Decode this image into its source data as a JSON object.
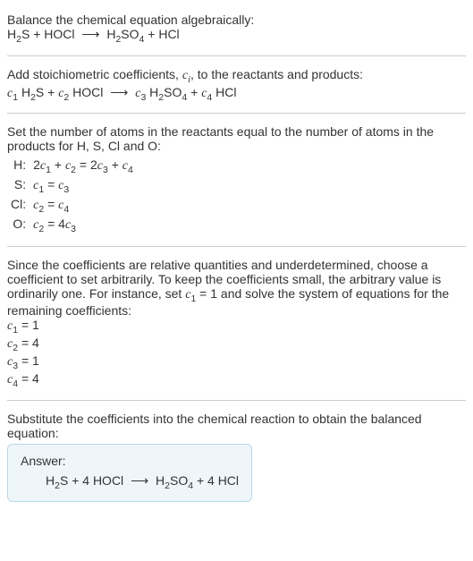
{
  "intro": {
    "line1_pre": "Balance the chemical equation algebraically:",
    "reaction_html": "H<sub>2</sub>S + HOCl <span class=\"arrow\">⟶</span> H<sub>2</sub>SO<sub>4</sub> + HCl"
  },
  "step_coeffs": {
    "text_html": "Add stoichiometric coefficients, <span class=\"ital\">c<sub>i</sub></span>, to the reactants and products:",
    "reaction_html": "<span class=\"ital\">c</span><sub>1</sub> H<sub>2</sub>S + <span class=\"ital\">c</span><sub>2</sub> HOCl <span class=\"arrow\">⟶</span> <span class=\"ital\">c</span><sub>3</sub> H<sub>2</sub>SO<sub>4</sub> + <span class=\"ital\">c</span><sub>4</sub> HCl"
  },
  "step_atoms": {
    "text": "Set the number of atoms in the reactants equal to the number of atoms in the products for H, S, Cl and O:",
    "rows": [
      {
        "el": "H:",
        "eq_html": "2<span class=\"ital\">c</span><sub>1</sub> + <span class=\"ital\">c</span><sub>2</sub> = 2<span class=\"ital\">c</span><sub>3</sub> + <span class=\"ital\">c</span><sub>4</sub>"
      },
      {
        "el": "S:",
        "eq_html": "<span class=\"ital\">c</span><sub>1</sub> = <span class=\"ital\">c</span><sub>3</sub>"
      },
      {
        "el": "Cl:",
        "eq_html": "<span class=\"ital\">c</span><sub>2</sub> = <span class=\"ital\">c</span><sub>4</sub>"
      },
      {
        "el": "O:",
        "eq_html": "<span class=\"ital\">c</span><sub>2</sub> = 4<span class=\"ital\">c</span><sub>3</sub>"
      }
    ]
  },
  "step_solve": {
    "text_html": "Since the coefficients are relative quantities and underdetermined, choose a coefficient to set arbitrarily. To keep the coefficients small, the arbitrary value is ordinarily one. For instance, set <span class=\"ital\">c</span><sub>1</sub> = 1 and solve the system of equations for the remaining coefficients:",
    "solutions_html": [
      "<span class=\"ital\">c</span><sub>1</sub> = 1",
      "<span class=\"ital\">c</span><sub>2</sub> = 4",
      "<span class=\"ital\">c</span><sub>3</sub> = 1",
      "<span class=\"ital\">c</span><sub>4</sub> = 4"
    ]
  },
  "step_sub": {
    "text": "Substitute the coefficients into the chemical reaction to obtain the balanced equation:"
  },
  "answer": {
    "label": "Answer:",
    "eq_html": "H<sub>2</sub>S + 4 HOCl <span class=\"arrow\">⟶</span> H<sub>2</sub>SO<sub>4</sub> + 4 HCl"
  }
}
